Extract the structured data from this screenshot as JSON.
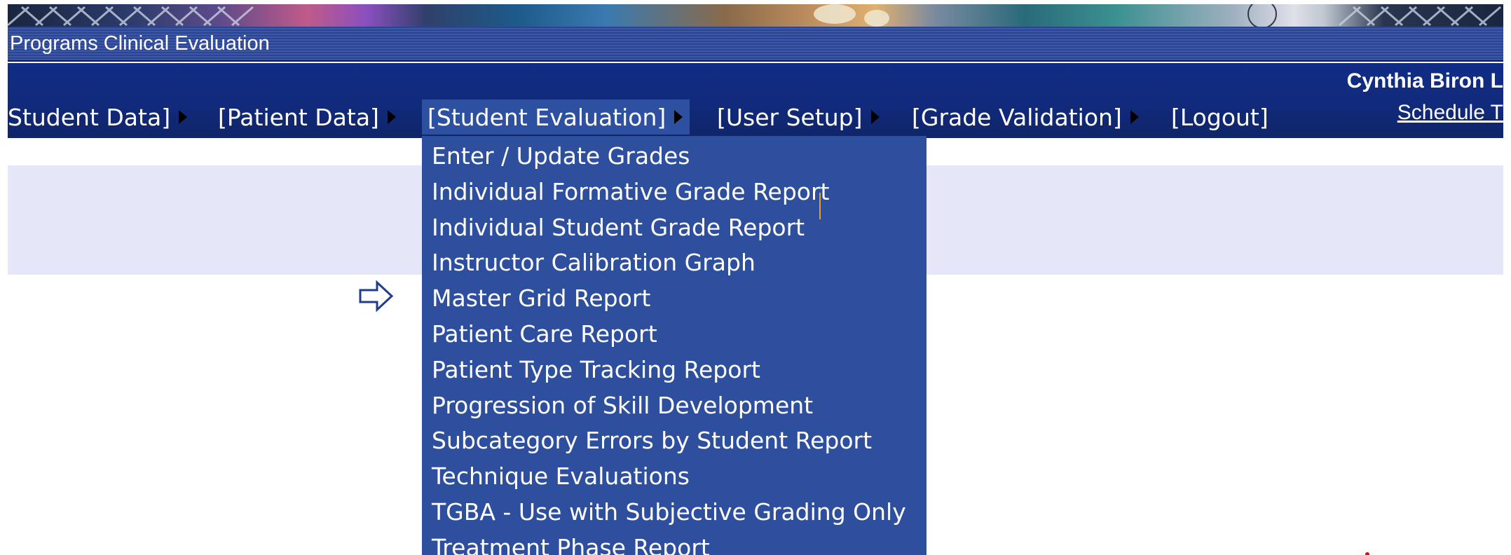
{
  "header": {
    "app_title": "Programs Clinical Evaluation",
    "user_name": "Cynthia Biron L",
    "schedule_link": "Schedule T"
  },
  "menu": [
    {
      "label": "Student Data]",
      "has_arrow": true
    },
    {
      "label": "[Patient Data]",
      "has_arrow": true
    },
    {
      "label": "[Student Evaluation]",
      "has_arrow": true,
      "active": true
    },
    {
      "label": "[User Setup]",
      "has_arrow": true
    },
    {
      "label": "[Grade Validation]",
      "has_arrow": true
    },
    {
      "label": "[Logout]",
      "has_arrow": false
    }
  ],
  "dropdown": {
    "items": [
      "Enter / Update Grades",
      "Individual Formative Grade Report",
      "Individual Student Grade Report",
      "Instructor Calibration Graph",
      "Master Grid Report",
      "Patient Care Report",
      "Patient Type Tracking Report",
      "Progression of Skill Development",
      "Subcategory Errors by Student Report",
      "Technique Evaluations",
      "TGBA - Use with Subjective Grading Only",
      "Treatment Phase Report"
    ]
  },
  "icons": {
    "pointer": "right-arrow-outline-icon",
    "submenu": "triangle-right-icon"
  },
  "colors": {
    "menu_bar": "#112a7c",
    "title_bar": "#2c4591",
    "dropdown_bg": "#2e4e9e",
    "band": "#e5e6f8"
  }
}
